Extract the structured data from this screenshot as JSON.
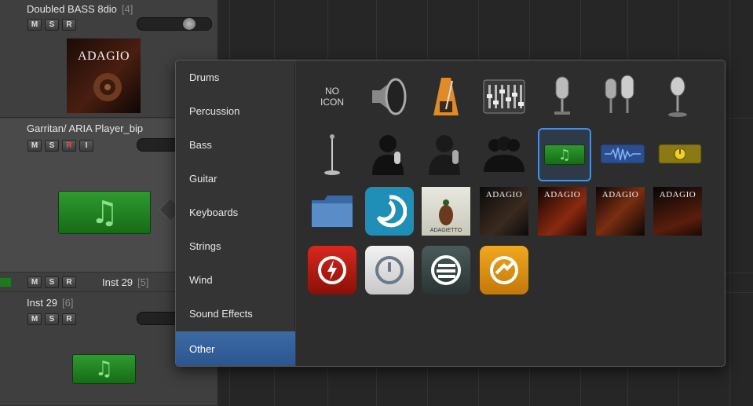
{
  "tracks": [
    {
      "name": "Doubled BASS 8dio",
      "num": "[4]",
      "buttons": [
        "M",
        "S",
        "R"
      ],
      "album_title": "ADAGIO"
    },
    {
      "name": "Garritan/ ARIA Player_bip",
      "num": "",
      "buttons": [
        "M",
        "S",
        "R",
        "I"
      ]
    },
    {
      "name": "Inst 29",
      "num": "[5]",
      "buttons": [
        "M",
        "S",
        "R"
      ]
    },
    {
      "name": "Inst 29",
      "num": "[6]",
      "buttons": [
        "M",
        "S",
        "R"
      ]
    }
  ],
  "popover": {
    "categories": [
      "Drums",
      "Percussion",
      "Bass",
      "Guitar",
      "Keyboards",
      "Strings",
      "Wind",
      "Sound Effects",
      "Other"
    ],
    "active_category": "Other",
    "no_icon_label": "NO\nICON",
    "album_title": "ADAGIO",
    "adagietto_label": "ADAGIETTO"
  },
  "colors": {
    "accent": "#3d6aa4",
    "selection_border": "#4a8fde",
    "note_green": "#2f9a2f"
  }
}
